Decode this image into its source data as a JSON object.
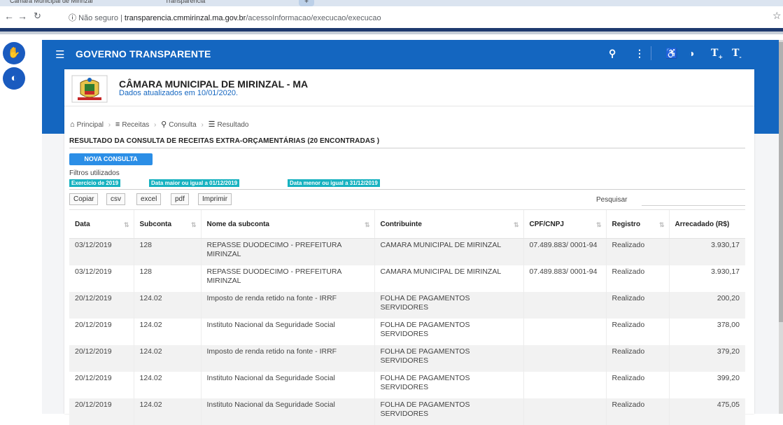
{
  "browser": {
    "tabs": [
      {
        "title": "Câmara Municipal de Mirinzal"
      },
      {
        "title": "Transparência"
      }
    ],
    "url": {
      "security": "Não seguro",
      "host": "transparencia.cmmirinzal.ma.gov.br",
      "path": "/acessoInformacao/execucao/execucao"
    }
  },
  "header": {
    "title": "GOVERNO TRANSPARENTE",
    "icons": [
      "search-icon",
      "more-vert-icon",
      "accessibility-icon",
      "contrast-icon",
      "font-increase-icon",
      "font-decrease-icon"
    ],
    "accent_color": "#1466c0"
  },
  "org": {
    "name": "CÂMARA MUNICIPAL DE MIRINZAL - MA",
    "updated": "Dados atualizados em 10/01/2020."
  },
  "breadcrumb": {
    "items": [
      "Principal",
      "Receitas",
      "Consulta",
      "Resultado"
    ]
  },
  "result": {
    "title": "RESULTADO DA CONSULTA DE RECEITAS EXTRA-ORÇAMENTÁRIAS (20 ENCONTRADAS )",
    "new_query_label": "NOVA CONSULTA",
    "filters_label": "Filtros utilizados",
    "filters": [
      "Exercício de 2019",
      "Data maior ou igual a 01/12/2019",
      "Data menor ou igual a 31/12/2019"
    ]
  },
  "toolbar": {
    "buttons": [
      "Copiar",
      "csv",
      "excel",
      "pdf",
      "Imprimir"
    ],
    "search_label": "Pesquisar",
    "search_value": ""
  },
  "table": {
    "columns": [
      "Data",
      "Subconta",
      "Nome da subconta",
      "Contribuinte",
      "CPF/CNPJ",
      "Registro",
      "Arrecadado (R$)"
    ],
    "rows": [
      [
        "03/12/2019",
        "128",
        "REPASSE DUODECIMO - PREFEITURA MIRINZAL",
        "CAMARA MUNICIPAL DE MIRINZAL",
        "07.489.883/ 0001-94",
        "Realizado",
        "3.930,17"
      ],
      [
        "03/12/2019",
        "128",
        "REPASSE DUODECIMO - PREFEITURA MIRINZAL",
        "CAMARA MUNICIPAL DE MIRINZAL",
        "07.489.883/ 0001-94",
        "Realizado",
        "3.930,17"
      ],
      [
        "20/12/2019",
        "124.02",
        "Imposto de renda retido na fonte - IRRF",
        "FOLHA DE PAGAMENTOS SERVIDORES",
        "",
        "Realizado",
        "200,20"
      ],
      [
        "20/12/2019",
        "124.02",
        "Instituto Nacional da Seguridade Social",
        "FOLHA DE PAGAMENTOS SERVIDORES",
        "",
        "Realizado",
        "378,00"
      ],
      [
        "20/12/2019",
        "124.02",
        "Imposto de renda retido na fonte - IRRF",
        "FOLHA DE PAGAMENTOS SERVIDORES",
        "",
        "Realizado",
        "379,20"
      ],
      [
        "20/12/2019",
        "124.02",
        "Instituto Nacional da Seguridade Social",
        "FOLHA DE PAGAMENTOS SERVIDORES",
        "",
        "Realizado",
        "399,20"
      ],
      [
        "20/12/2019",
        "124.02",
        "Instituto Nacional da Seguridade Social",
        "FOLHA DE PAGAMENTOS SERVIDORES",
        "",
        "Realizado",
        "475,05"
      ]
    ]
  }
}
